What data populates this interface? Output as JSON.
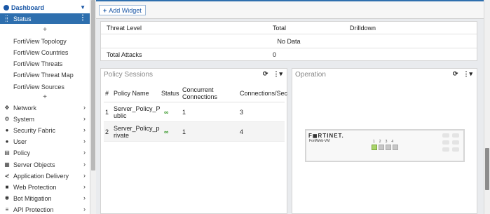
{
  "sidebar": {
    "dashboard_label": "Dashboard",
    "status_label": "Status",
    "status_menu": "⋮",
    "add_symbol": "+",
    "fortiview_items": [
      {
        "label": "FortiView Topology"
      },
      {
        "label": "FortiView Countries"
      },
      {
        "label": "FortiView Threats"
      },
      {
        "label": "FortiView Threat Map"
      },
      {
        "label": "FortiView Sources"
      }
    ],
    "items": [
      {
        "label": "Network",
        "icon": "network-icon"
      },
      {
        "label": "System",
        "icon": "gear-icon"
      },
      {
        "label": "Security Fabric",
        "icon": "fabric-icon"
      },
      {
        "label": "User",
        "icon": "user-icon"
      },
      {
        "label": "Policy",
        "icon": "policy-icon"
      },
      {
        "label": "Server Objects",
        "icon": "server-icon"
      },
      {
        "label": "Application Delivery",
        "icon": "delivery-icon"
      },
      {
        "label": "Web Protection",
        "icon": "lock-icon"
      },
      {
        "label": "Bot Mitigation",
        "icon": "bot-icon"
      },
      {
        "label": "API Protection",
        "icon": "api-icon"
      }
    ]
  },
  "toolbar": {
    "add_widget_label": "Add Widget",
    "add_widget_icon": "+"
  },
  "attack_widget": {
    "headers": [
      "Threat Level",
      "Total",
      "Drilldown"
    ],
    "no_data": "No Data",
    "total_label": "Total Attacks",
    "total_value": "0"
  },
  "policy_sessions": {
    "title": "Policy Sessions",
    "columns": {
      "num": "#",
      "name": "Policy Name",
      "status": "Status",
      "concurrent_1": "Concurrent",
      "concurrent_2": "Connections",
      "cps": "Connections/Sec"
    },
    "rows": [
      {
        "num": "1",
        "name_1": "Server_Policy_P",
        "name_2": "ublic",
        "concurrent": "1",
        "cps": "3"
      },
      {
        "num": "2",
        "name_1": "Server_Policy_p",
        "name_2": "rivate",
        "concurrent": "1",
        "cps": "4"
      }
    ]
  },
  "operation": {
    "title": "Operation",
    "device_logo": "F◼RTINET.",
    "device_model": "FortiWeb-VM",
    "ports": [
      "1",
      "2",
      "3",
      "4"
    ]
  },
  "colors": {
    "accent": "#2e6fae",
    "link": "#1a57a6",
    "status_ok": "#3c9a2e"
  }
}
